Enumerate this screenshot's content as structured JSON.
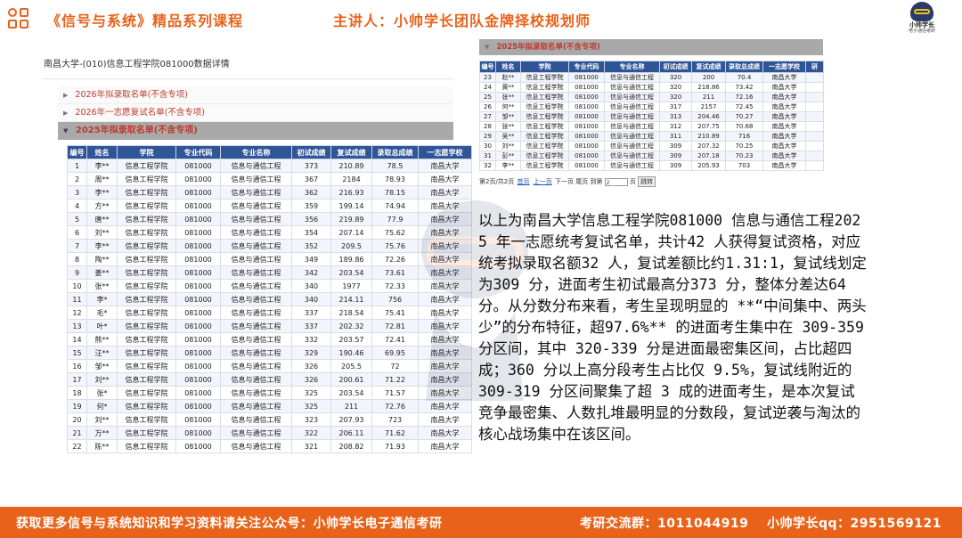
{
  "header": {
    "course_title": "《信号与系统》精品系列课程",
    "lecturer": "主讲人：小帅学长团队金牌择校规划师",
    "logo_line1": "小帅学长",
    "logo_line2": "电子通信考研",
    "accent_color": "#e8621a"
  },
  "left_panel": {
    "page_header": "南昌大学-(010)信息工程学院081000数据详情",
    "accordion": [
      {
        "label": "2026年拟录取名单(不含专项)",
        "expanded": false
      },
      {
        "label": "2026年一志愿复试名单(不含专项)",
        "expanded": false
      },
      {
        "label": "2025年拟录取名单(不含专项)",
        "expanded": true
      }
    ],
    "columns": [
      "编号",
      "姓名",
      "学院",
      "专业代码",
      "专业名称",
      "初试成绩",
      "复试成绩",
      "录取总成绩",
      "一志愿学校"
    ],
    "rows": [
      [
        "1",
        "李**",
        "信息工程学院",
        "081000",
        "信息与通信工程",
        "373",
        "210.89",
        "78.5",
        "南昌大学"
      ],
      [
        "2",
        "周**",
        "信息工程学院",
        "081000",
        "信息与通信工程",
        "367",
        "2184",
        "78.93",
        "南昌大学"
      ],
      [
        "3",
        "李**",
        "信息工程学院",
        "081000",
        "信息与通信工程",
        "362",
        "216.93",
        "78.15",
        "南昌大学"
      ],
      [
        "4",
        "方**",
        "信息工程学院",
        "081000",
        "信息与通信工程",
        "359",
        "199.14",
        "74.94",
        "南昌大学"
      ],
      [
        "5",
        "唐**",
        "信息工程学院",
        "081000",
        "信息与通信工程",
        "356",
        "219.89",
        "77.9",
        "南昌大学"
      ],
      [
        "6",
        "刘**",
        "信息工程学院",
        "081000",
        "信息与通信工程",
        "354",
        "207.14",
        "75.62",
        "南昌大学"
      ],
      [
        "7",
        "李**",
        "信息工程学院",
        "081000",
        "信息与通信工程",
        "352",
        "209.5",
        "75.76",
        "南昌大学"
      ],
      [
        "8",
        "陶**",
        "信息工程学院",
        "081000",
        "信息与通信工程",
        "349",
        "189.86",
        "72.26",
        "南昌大学"
      ],
      [
        "9",
        "姜**",
        "信息工程学院",
        "081000",
        "信息与通信工程",
        "342",
        "203.54",
        "73.61",
        "南昌大学"
      ],
      [
        "10",
        "张**",
        "信息工程学院",
        "081000",
        "信息与通信工程",
        "340",
        "1977",
        "72.33",
        "南昌大学"
      ],
      [
        "11",
        "李*",
        "信息工程学院",
        "081000",
        "信息与通信工程",
        "340",
        "214.11",
        "756",
        "南昌大学"
      ],
      [
        "12",
        "毛*",
        "信息工程学院",
        "081000",
        "信息与通信工程",
        "337",
        "218.54",
        "75.41",
        "南昌大学"
      ],
      [
        "13",
        "叶*",
        "信息工程学院",
        "081000",
        "信息与通信工程",
        "337",
        "202.32",
        "72.81",
        "南昌大学"
      ],
      [
        "14",
        "熊**",
        "信息工程学院",
        "081000",
        "信息与通信工程",
        "332",
        "203.57",
        "72.41",
        "南昌大学"
      ],
      [
        "15",
        "汪**",
        "信息工程学院",
        "081000",
        "信息与通信工程",
        "329",
        "190.46",
        "69.95",
        "南昌大学"
      ],
      [
        "16",
        "邹**",
        "信息工程学院",
        "081000",
        "信息与通信工程",
        "326",
        "205.5",
        "72",
        "南昌大学"
      ],
      [
        "17",
        "刘**",
        "信息工程学院",
        "081000",
        "信息与通信工程",
        "326",
        "200.61",
        "71.22",
        "南昌大学"
      ],
      [
        "18",
        "张*",
        "信息工程学院",
        "081000",
        "信息与通信工程",
        "325",
        "203.54",
        "71.57",
        "南昌大学"
      ],
      [
        "19",
        "何*",
        "信息工程学院",
        "081000",
        "信息与通信工程",
        "325",
        "211",
        "72.76",
        "南昌大学"
      ],
      [
        "20",
        "刘**",
        "信息工程学院",
        "081000",
        "信息与通信工程",
        "323",
        "207.93",
        "723",
        "南昌大学"
      ],
      [
        "21",
        "万**",
        "信息工程学院",
        "081000",
        "信息与通信工程",
        "322",
        "206.11",
        "71.62",
        "南昌大学"
      ],
      [
        "22",
        "陈**",
        "信息工程学院",
        "081000",
        "信息与通信工程",
        "321",
        "208.82",
        "71.93",
        "南昌大学"
      ]
    ]
  },
  "right_panel": {
    "accordion_label": "2025年拟录取名单(不含专项)",
    "columns": [
      "编号",
      "姓名",
      "学院",
      "专业代码",
      "专业名称",
      "初试成绩",
      "复试成绩",
      "录取总成绩",
      "一志愿学校",
      "研"
    ],
    "rows": [
      [
        "23",
        "赵**",
        "信息工程学院",
        "081000",
        "信息与通信工程",
        "320",
        "200",
        "70.4",
        "南昌大学",
        ""
      ],
      [
        "24",
        "黄**",
        "信息工程学院",
        "081000",
        "信息与通信工程",
        "320",
        "218.86",
        "73.42",
        "南昌大学",
        ""
      ],
      [
        "25",
        "张**",
        "信息工程学院",
        "081000",
        "信息与通信工程",
        "320",
        "211",
        "72.16",
        "南昌大学",
        ""
      ],
      [
        "26",
        "何**",
        "信息工程学院",
        "081000",
        "信息与通信工程",
        "317",
        "2157",
        "72.45",
        "南昌大学",
        ""
      ],
      [
        "27",
        "邹**",
        "信息工程学院",
        "081000",
        "信息与通信工程",
        "313",
        "204.46",
        "70.27",
        "南昌大学",
        ""
      ],
      [
        "28",
        "张**",
        "信息工程学院",
        "081000",
        "信息与通信工程",
        "312",
        "207.75",
        "70.68",
        "南昌大学",
        ""
      ],
      [
        "29",
        "吴**",
        "信息工程学院",
        "081000",
        "信息与通信工程",
        "311",
        "210.89",
        "716",
        "南昌大学",
        ""
      ],
      [
        "30",
        "刘**",
        "信息工程学院",
        "081000",
        "信息与通信工程",
        "309",
        "207.32",
        "70.25",
        "南昌大学",
        ""
      ],
      [
        "31",
        "彭**",
        "信息工程学院",
        "081000",
        "信息与通信工程",
        "309",
        "207.18",
        "70.23",
        "南昌大学",
        ""
      ],
      [
        "32",
        "李**",
        "信息工程学院",
        "081000",
        "信息与通信工程",
        "309",
        "205.93",
        "703",
        "南昌大学",
        ""
      ]
    ],
    "pager": {
      "info": "第2页/共2页",
      "first": "首页",
      "prev": "上一页",
      "next": "下一页",
      "last": "尾页",
      "goto_label": "到第",
      "goto_value": "2",
      "page_unit": "页",
      "jump": "跳转"
    }
  },
  "analysis": {
    "text": "以上为南昌大学信息工程学院081000 信息与通信工程2025 年一志愿统考复试名单，共计42 人获得复试资格，对应统考拟录取名额32 人，复试差额比约1.31:1，复试线划定为309 分，进面考生初试最高分373 分，整体分差达64 分。从分数分布来看，考生呈现明显的 **“中间集中、两头少”的分布特征，超97.6%** 的进面考生集中在 309-359 分区间，其中 320-339 分是进面最密集区间，占比超四成；360 分以上高分段考生占比仅 9.5%，复试线附近的 309-319 分区间聚集了超 3 成的进面考生，是本次复试竞争最密集、人数扎堆最明显的分数段，复试逆袭与淘汰的核心战场集中在该区间。"
  },
  "footer": {
    "promo": "获取更多信号与系统知识和学习资料请关注公众号：小帅学长电子通信考研",
    "group": "考研交流群：1011044919",
    "qq": "小帅学长qq：2951569121"
  }
}
